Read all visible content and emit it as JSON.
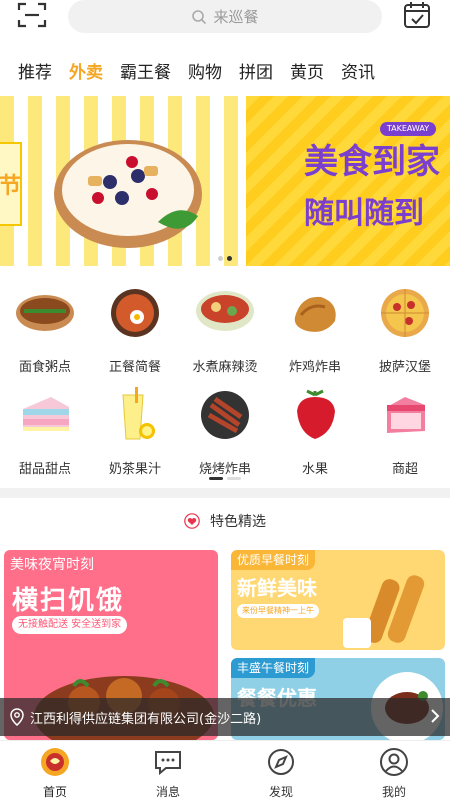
{
  "search": {
    "placeholder": "来巡餐"
  },
  "tabs": [
    {
      "label": "推荐",
      "active": false
    },
    {
      "label": "外卖",
      "active": true
    },
    {
      "label": "霸王餐",
      "active": false
    },
    {
      "label": "购物",
      "active": false
    },
    {
      "label": "拼团",
      "active": false
    },
    {
      "label": "黄页",
      "active": false
    },
    {
      "label": "资讯",
      "active": false
    }
  ],
  "banner": {
    "left_sign": "节",
    "right_badge": "TAKEAWAY",
    "right_title": "美食到家",
    "right_subtitle": "随叫随到"
  },
  "categories": [
    {
      "label": "面食粥点",
      "icon": "noodle-bun-icon"
    },
    {
      "label": "正餐简餐",
      "icon": "meal-pot-icon"
    },
    {
      "label": "水煮麻辣烫",
      "icon": "hotpot-bowl-icon"
    },
    {
      "label": "炸鸡炸串",
      "icon": "fried-chicken-icon"
    },
    {
      "label": "披萨汉堡",
      "icon": "pizza-icon"
    },
    {
      "label": "甜品甜点",
      "icon": "cake-icon"
    },
    {
      "label": "奶茶果汁",
      "icon": "juice-cup-icon"
    },
    {
      "label": "烧烤炸串",
      "icon": "bbq-icon"
    },
    {
      "label": "水果",
      "icon": "strawberry-icon"
    },
    {
      "label": "商超",
      "icon": "store-icon"
    }
  ],
  "featured": {
    "title": "特色精选",
    "cards": {
      "night": {
        "tag": "美味夜宵时刻",
        "title": "横扫饥饿",
        "pill": "无接触配送 安全送到家"
      },
      "breakfast": {
        "tag": "优质早餐时刻",
        "title": "新鲜美味",
        "pill": "来份早餐精神一上午"
      },
      "lunch": {
        "tag": "丰盛午餐时刻",
        "title": "餐餐优惠"
      }
    }
  },
  "location": {
    "text": "江西利得供应链集团有限公司(金沙二路)"
  },
  "nav": [
    {
      "label": "首页",
      "icon": "home-logo-icon",
      "active": true
    },
    {
      "label": "消息",
      "icon": "message-icon",
      "active": false
    },
    {
      "label": "发现",
      "icon": "discover-icon",
      "active": false
    },
    {
      "label": "我的",
      "icon": "profile-icon",
      "active": false
    }
  ],
  "colors": {
    "accent": "#f5a623",
    "banner_purple": "#7b3fd0",
    "night_card": "#ff6f8a",
    "breakfast_card": "#ffd873",
    "lunch_card": "#8fd0e6"
  }
}
